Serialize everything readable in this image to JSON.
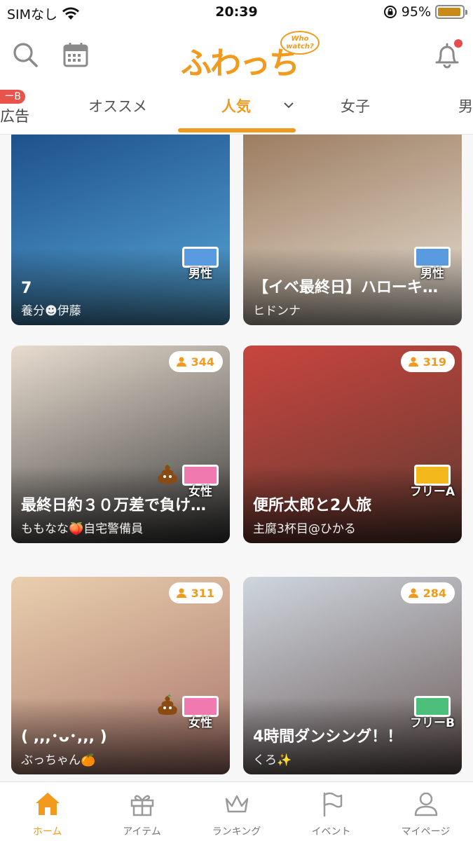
{
  "status_bar": {
    "carrier": "SIMなし",
    "time": "20:39",
    "battery": "95%",
    "battery_level": 0.95
  },
  "header": {
    "logo_text": "ふわっち",
    "logo_bubble_line1": "Who",
    "logo_bubble_line2": "watch?"
  },
  "tabs": {
    "ad_badge": "ーB",
    "ad_label": "広告",
    "items": [
      "オススメ",
      "人気",
      "女子",
      "男"
    ],
    "active": "人気"
  },
  "feed": {
    "cards": [
      {
        "title": "7",
        "user": "養分☻伊藤",
        "genre": "男性",
        "genre_color": "#5a9ae0",
        "bg1": "#1d4f8a",
        "bg2": "#58a8d8"
      },
      {
        "title": "【イベ最終日】ハローキ…",
        "user": "ヒドンナ",
        "genre": "男性",
        "genre_color": "#5a9ae0",
        "bg1": "#9a7a5e",
        "bg2": "#e8e0d4"
      },
      {
        "title": "最終日約３０万差で負け…",
        "user": "ももなな🍑自宅警備員",
        "genre": "女性",
        "genre_color": "#f07ab0",
        "viewers": "344",
        "bg1": "#e8dccf",
        "bg2": "#3a3a3a"
      },
      {
        "title": "便所太郎と2人旅",
        "user": "主腐3杯目@ひかる",
        "genre": "フリーA",
        "genre_color": "#f2b81c",
        "viewers": "319",
        "bg1": "#c9453f",
        "bg2": "#5e3a30"
      },
      {
        "title": "( ,,,･ᴗ･,,, )",
        "user": "ぶっちゃん🍊",
        "genre": "女性",
        "genre_color": "#f07ab0",
        "viewers": "311",
        "bg1": "#e9cfae",
        "bg2": "#a8746a"
      },
      {
        "title": "4時間ダンシング！！",
        "user": "くろ✨",
        "genre": "フリーB",
        "genre_color": "#4cc07a",
        "viewers": "284",
        "bg1": "#cfd6de",
        "bg2": "#6a5a58"
      }
    ]
  },
  "bottom_nav": {
    "items": [
      "ホーム",
      "アイテム",
      "ランキング",
      "イベント",
      "マイページ"
    ],
    "active": "ホーム",
    "accent": "#f29a1e"
  }
}
